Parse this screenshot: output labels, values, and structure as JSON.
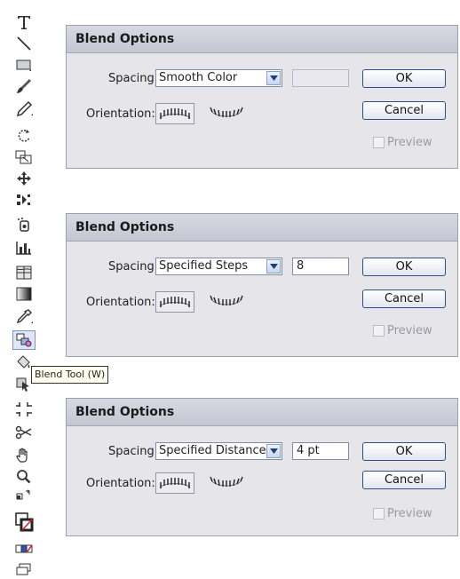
{
  "toolbar": {
    "tooltip": "Blend Tool (W)",
    "tools": [
      "type-tool",
      "line-tool",
      "rectangle-tool",
      "paintbrush-tool",
      "pencil-tool",
      "rotate-tool",
      "scale-tool",
      "free-transform-tool",
      "symbol-sprayer-tool",
      "column-graph-tool",
      "mesh-tool",
      "gradient-tool",
      "eyedropper-tool",
      "blend-tool",
      "live-paint-bucket-tool",
      "live-paint-selection-tool",
      "slice-tool",
      "scissors-tool",
      "hand-tool",
      "zoom-tool",
      "swap-fill-stroke",
      "fill-stroke-swatch",
      "color-mode",
      "screen-mode"
    ]
  },
  "dialogs": [
    {
      "title": "Blend Options",
      "spacing_label": "Spacing:",
      "spacing_value": "Smooth Color",
      "field_value": "",
      "field_enabled": false,
      "orientation_label": "Orientation:",
      "ok_label": "OK",
      "cancel_label": "Cancel",
      "preview_label": "Preview"
    },
    {
      "title": "Blend Options",
      "spacing_label": "Spacing:",
      "spacing_value": "Specified Steps",
      "field_value": "8",
      "field_enabled": true,
      "orientation_label": "Orientation:",
      "ok_label": "OK",
      "cancel_label": "Cancel",
      "preview_label": "Preview"
    },
    {
      "title": "Blend Options",
      "spacing_label": "Spacing:",
      "spacing_value": "Specified Distance",
      "field_value": "4 pt",
      "field_enabled": true,
      "orientation_label": "Orientation:",
      "ok_label": "OK",
      "cancel_label": "Cancel",
      "preview_label": "Preview"
    }
  ]
}
